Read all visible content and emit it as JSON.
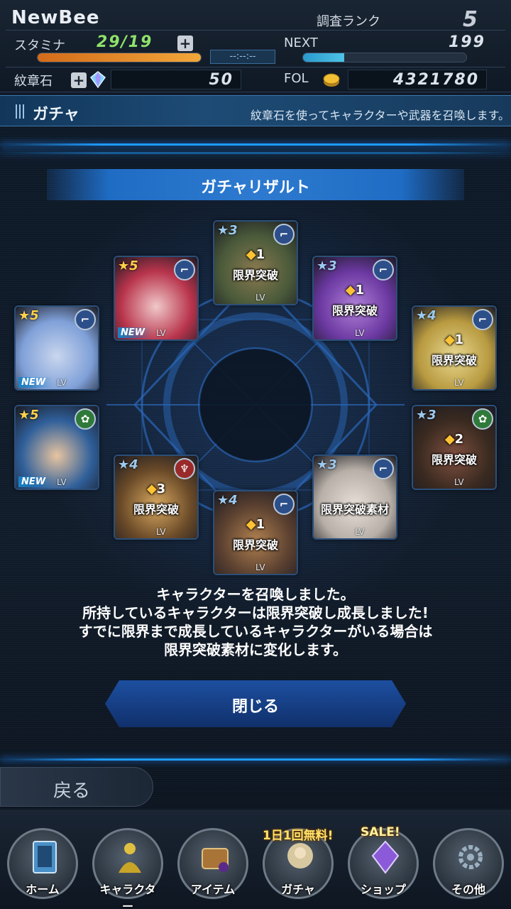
{
  "header": {
    "player_name": "NewBee",
    "rank_label": "調査ランク",
    "rank_value": "5",
    "stamina_label": "スタミナ",
    "stamina_value": "29/19",
    "stamina_fraction": 1.0,
    "timer": "--:--:--",
    "next_label": "NEXT",
    "next_value": "199",
    "next_fraction": 0.25,
    "crest_label": "紋章石",
    "crest_value": "50",
    "fol_label": "FOL",
    "fol_value": "4321780"
  },
  "gacha_bar": {
    "title": "ガチャ",
    "description": "紋章石を使ってキャラクターや武器を召喚します。"
  },
  "result": {
    "title": "ガチャリザルト",
    "cards": [
      {
        "star": "★5",
        "attr": "gun",
        "new": "NEW",
        "lv": "LV",
        "gem": "",
        "limit": ""
      },
      {
        "star": "★5",
        "attr": "heal",
        "new": "NEW",
        "lv": "LV",
        "gem": "",
        "limit": ""
      },
      {
        "star": "★5",
        "attr": "gun",
        "new": "NEW",
        "lv": "LV",
        "gem": "",
        "limit": ""
      },
      {
        "star": "★4",
        "attr": "attack",
        "new": "",
        "lv": "LV",
        "gem": "3",
        "limit": "限界突破"
      },
      {
        "star": "★3",
        "attr": "gun",
        "new": "",
        "lv": "LV",
        "gem": "1",
        "limit": "限界突破"
      },
      {
        "star": "★4",
        "attr": "gun",
        "new": "",
        "lv": "LV",
        "gem": "1",
        "limit": "限界突破"
      },
      {
        "star": "★3",
        "attr": "gun",
        "new": "",
        "lv": "LV",
        "gem": "1",
        "limit": "限界突破"
      },
      {
        "star": "★3",
        "attr": "gun",
        "new": "",
        "lv": "LV",
        "gem": "",
        "limit": "限界突破素材"
      },
      {
        "star": "★4",
        "attr": "gun",
        "new": "",
        "lv": "LV",
        "gem": "1",
        "limit": "限界突破"
      },
      {
        "star": "★3",
        "attr": "heal",
        "new": "",
        "lv": "LV",
        "gem": "2",
        "limit": "限界突破"
      }
    ],
    "message_lines": [
      "キャラクターを召喚しました。",
      "所持しているキャラクターは限界突破し成長しました!",
      "すでに限界まで成長しているキャラクターがいる場合は",
      "限界突破素材に変化します。"
    ],
    "close_label": "閉じる"
  },
  "back_label": "戻る",
  "nav": {
    "items": [
      {
        "label": "ホーム",
        "icon": "home-icon"
      },
      {
        "label": "キャラクター",
        "icon": "character-icon"
      },
      {
        "label": "アイテム",
        "icon": "item-icon"
      },
      {
        "label": "ガチャ",
        "icon": "gacha-icon"
      },
      {
        "label": "ショップ",
        "icon": "shop-icon"
      },
      {
        "label": "その他",
        "icon": "gear-icon"
      }
    ],
    "gacha_badge": "1日1回無料!",
    "shop_badge": "SALE!"
  },
  "colors": {
    "accent_blue": "#1f9cff",
    "stamina_orange": "#f0a73a",
    "stamina_text": "#8fe26a",
    "star_gold": "#ffd24a"
  }
}
